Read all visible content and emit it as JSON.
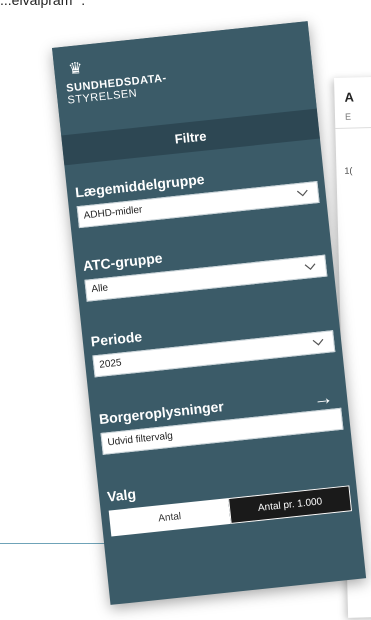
{
  "top_text": "...elvalpram \".",
  "report": {
    "title": "A",
    "subtitle": "E",
    "value": "1("
  },
  "header": {
    "logo_line1": "SUNDHEDSDATA-",
    "logo_line2": "STYRELSEN"
  },
  "filters_title": "Filtre",
  "filters": [
    {
      "label": "Lægemiddelgruppe",
      "value": "ADHD-midler"
    },
    {
      "label": "ATC-gruppe",
      "value": "Alle"
    },
    {
      "label": "Periode",
      "value": "2025"
    }
  ],
  "citizen": {
    "label": "Borgeroplysninger",
    "value": "Udvid filtervalg"
  },
  "valg": {
    "label": "Valg",
    "options": [
      "Antal",
      "Antal pr. 1.000"
    ],
    "selected": "Antal pr. 1.000"
  },
  "colors": {
    "panel": "#3b5b68",
    "panel_dark": "#2d4753",
    "selected_toggle": "#1a1a1a"
  }
}
